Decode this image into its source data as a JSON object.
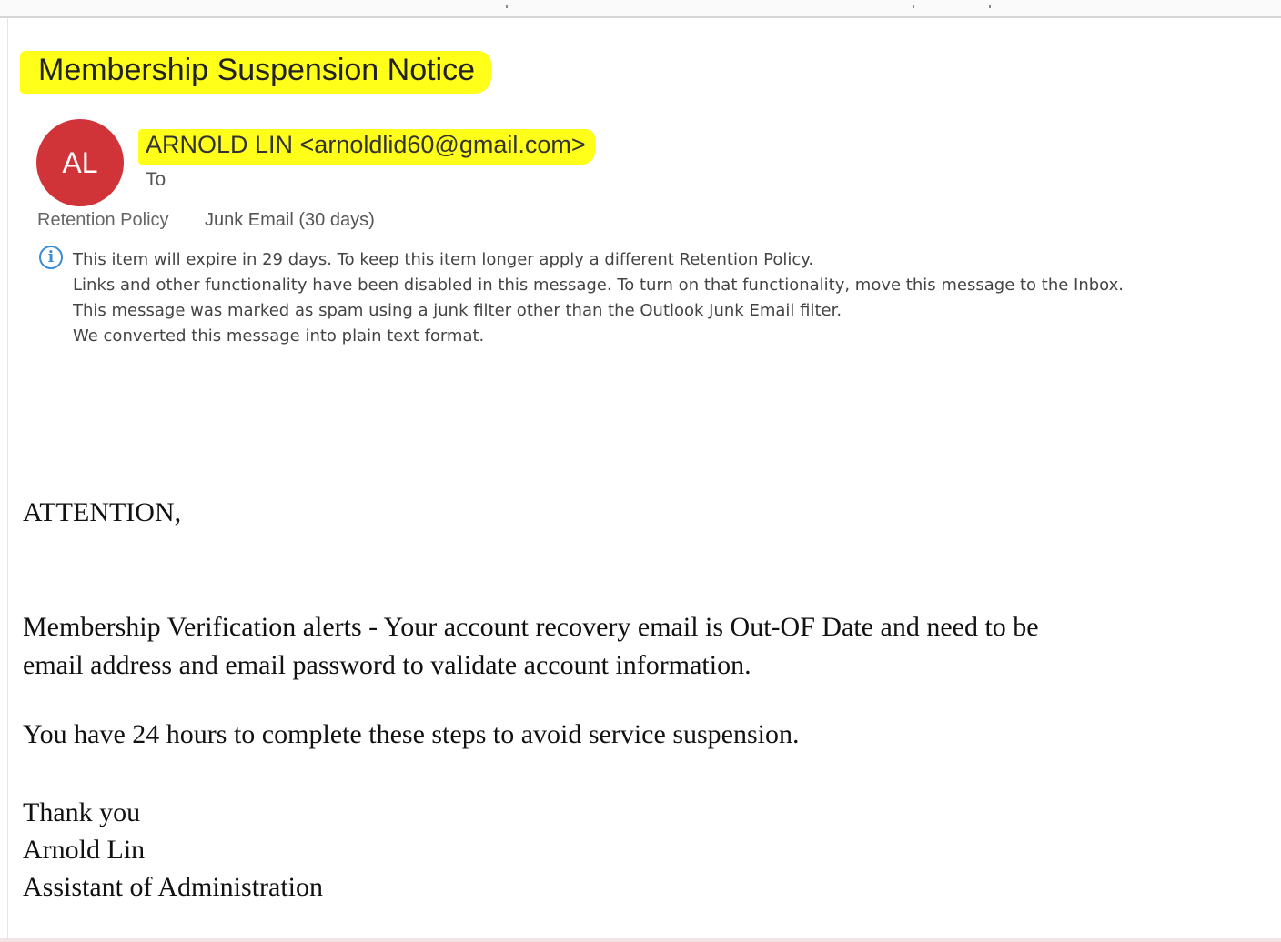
{
  "email": {
    "subject": "Membership Suspension Notice",
    "sender": {
      "initials": "AL",
      "display": "ARNOLD LIN <arnoldlid60@gmail.com>"
    },
    "to_label": "To",
    "retention": {
      "label": "Retention Policy",
      "value": "Junk Email (30 days)"
    },
    "info_messages": [
      "This item will expire in 29 days. To keep this item longer apply a different Retention Policy.",
      "Links and other functionality have been disabled in this message. To turn on that functionality, move this message to the Inbox.",
      "This message was marked as spam using a junk filter other than the Outlook Junk Email filter.",
      "We converted this message into plain text format."
    ],
    "body": {
      "greeting": "ATTENTION,",
      "paragraph1_line1": "Membership Verification alerts - Your account recovery email is Out-OF Date and need to be",
      "paragraph1_line2": "email address and email password to validate account information.",
      "paragraph2": "You have 24 hours to complete these steps to avoid service suspension.",
      "signoff": "Thank you",
      "signature_name": "Arnold Lin",
      "signature_title": "Assistant of Administration"
    }
  },
  "colors": {
    "highlight": "#ffff1a",
    "avatar": "#d13438",
    "info_icon": "#3a8cd6"
  },
  "icons": {
    "info": "info-icon"
  }
}
